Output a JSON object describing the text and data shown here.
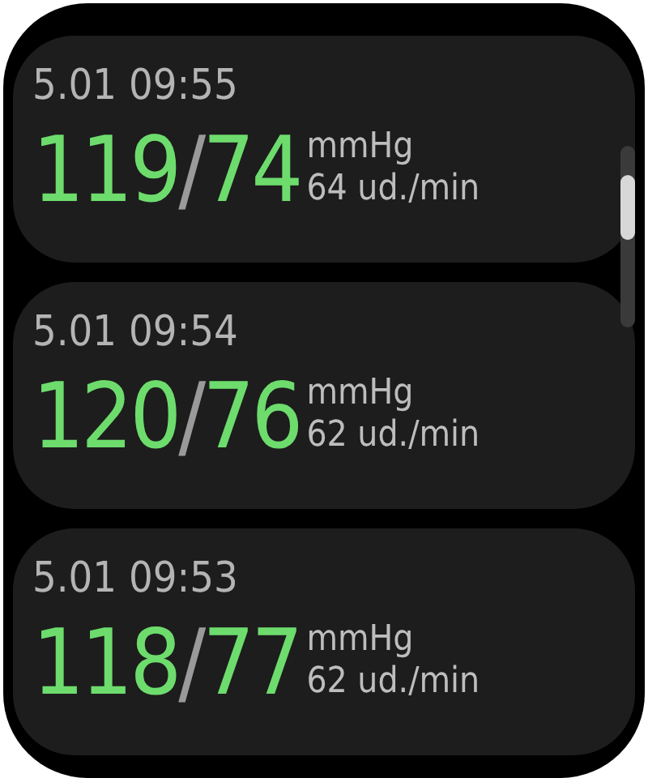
{
  "readings": [
    {
      "time": "5.01 09:55",
      "systolic": "119",
      "separator": "/",
      "diastolic": "74",
      "pressure_unit": "mmHg",
      "pulse": "64 ud./min"
    },
    {
      "time": "5.01 09:54",
      "systolic": "120",
      "separator": "/",
      "diastolic": "76",
      "pressure_unit": "mmHg",
      "pulse": "62 ud./min"
    },
    {
      "time": "5.01 09:53",
      "systolic": "118",
      "separator": "/",
      "diastolic": "77",
      "pressure_unit": "mmHg",
      "pulse": "62 ud./min"
    }
  ]
}
